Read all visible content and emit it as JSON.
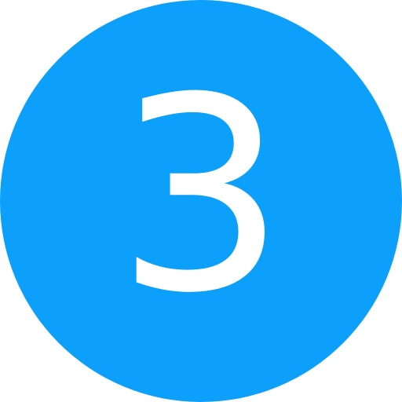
{
  "badge": {
    "number": "3",
    "background_color": "#0da0fb",
    "text_color": "#ffffff",
    "icon": "number-circle-icon"
  }
}
